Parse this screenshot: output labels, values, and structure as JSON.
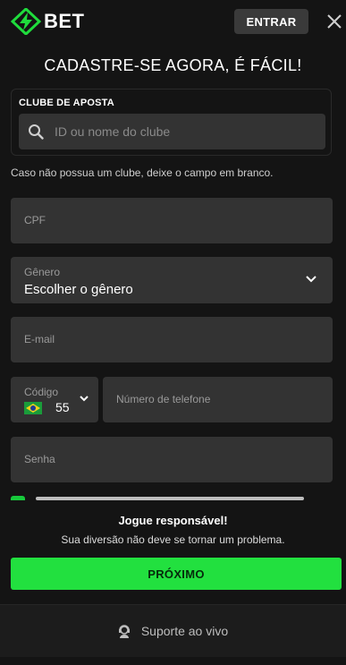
{
  "header": {
    "logo_text": "BET",
    "login_label": "ENTRAR",
    "brand_color": "#1fdc3c"
  },
  "page": {
    "title": "CADASTRE-SE AGORA, É FÁCIL!"
  },
  "club": {
    "label": "CLUBE DE APOSTA",
    "placeholder": "ID ou nome do clube",
    "hint": "Caso não possua um clube, deixe o campo em branco."
  },
  "form": {
    "cpf_placeholder": "CPF",
    "gender_label": "Gênero",
    "gender_value": "Escolher o gênero",
    "email_placeholder": "E-mail",
    "code_label": "Código",
    "code_value": "55",
    "phone_placeholder": "Número de telefone",
    "password_placeholder": "Senha"
  },
  "notice": {
    "title": "Jogue responsável!",
    "subtitle": "Sua diversão não deve se tornar um problema."
  },
  "actions": {
    "next_label": "PRÓXIMO"
  },
  "footer": {
    "support_label": "Suporte ao vivo"
  },
  "icons": [
    "logo-icon",
    "close-icon",
    "search-icon",
    "chevron-down-icon",
    "brazil-flag-icon",
    "support-icon",
    "check-icon"
  ]
}
